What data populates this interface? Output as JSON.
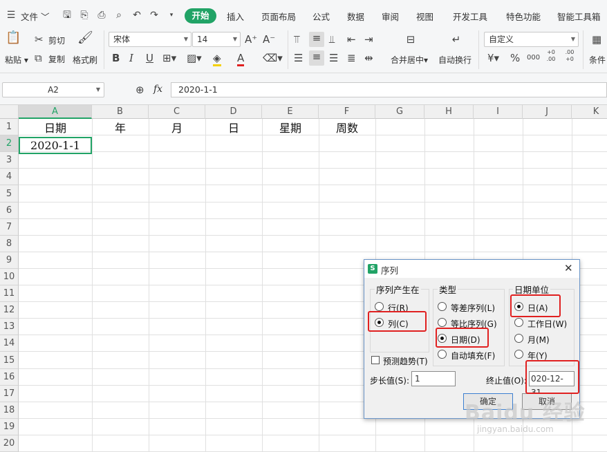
{
  "menubar": {
    "file_label": "文件",
    "tabs": [
      "开始",
      "插入",
      "页面布局",
      "公式",
      "数据",
      "审阅",
      "视图",
      "开发工具",
      "特色功能",
      "智能工具箱"
    ]
  },
  "ribbon": {
    "paste": "粘贴",
    "cut": "剪切",
    "copy": "复制",
    "format_painter": "格式刷",
    "font_name": "宋体",
    "font_size": "14",
    "merge_center": "合并居中",
    "wrap_text": "自动换行",
    "number_format": "自定义",
    "conditional": "条件",
    "currency_symbol": "¥",
    "percent_symbol": "%",
    "thousands_symbol": "000",
    "increase_decimal": "+0 .00",
    "decrease_decimal": ".00 +0"
  },
  "formula_bar": {
    "name_box": "A2",
    "fx": "fx",
    "value": "2020-1-1"
  },
  "sheet": {
    "columns": [
      "A",
      "B",
      "C",
      "D",
      "E",
      "F",
      "G",
      "H",
      "I",
      "J",
      "K"
    ],
    "rows": [
      "1",
      "2",
      "3",
      "4",
      "5",
      "6",
      "7",
      "8",
      "9",
      "10",
      "11",
      "12",
      "13",
      "14",
      "15",
      "16",
      "17",
      "18",
      "19",
      "20"
    ],
    "cells": {
      "A1": "日期",
      "B1": "年",
      "C1": "月",
      "D1": "日",
      "E1": "星期",
      "F1": "周数",
      "A2": "2020-1-1"
    }
  },
  "dialog": {
    "logo": "S",
    "title": "序列",
    "group_series_in": "序列产生在",
    "opt_rows": "行(R)",
    "opt_cols": "列(C)",
    "group_type": "类型",
    "opt_linear": "等差序列(L)",
    "opt_growth": "等比序列(G)",
    "opt_date": "日期(D)",
    "opt_autofill": "自动填充(F)",
    "group_date_unit": "日期单位",
    "opt_day": "日(A)",
    "opt_weekday": "工作日(W)",
    "opt_month": "月(M)",
    "opt_year": "年(Y)",
    "trend": "预测趋势(T)",
    "step_label": "步长值(S):",
    "step_value": "1",
    "stop_label": "终止值(O):",
    "stop_value": "020-12-31",
    "ok": "确定",
    "cancel": "取消"
  },
  "watermark": {
    "main": "Baidu 经验",
    "sub": "jingyan.baidu.com"
  }
}
